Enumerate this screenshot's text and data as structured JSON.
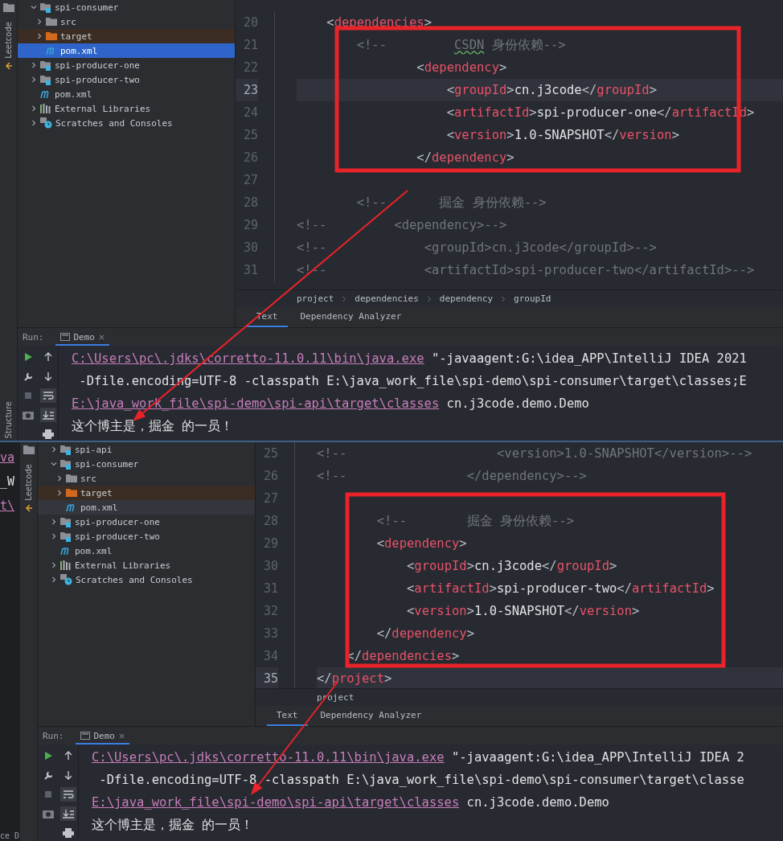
{
  "screens": [
    {
      "side_strip": {
        "top_label": "Leetcode",
        "bottom_label": "Structure"
      },
      "tree": {
        "focused": true,
        "items": [
          {
            "label": "spi-consumer",
            "kind": "module",
            "expanded": true,
            "selected": false,
            "children": [
              {
                "label": "src",
                "kind": "folder",
                "expanded": false,
                "selected": false
              },
              {
                "label": "target",
                "kind": "excluded",
                "expanded": false,
                "selected": false
              },
              {
                "label": "pom.xml",
                "kind": "maven",
                "selected": true
              }
            ]
          },
          {
            "label": "spi-producer-one",
            "kind": "module",
            "expanded": false,
            "selected": false
          },
          {
            "label": "spi-producer-two",
            "kind": "module",
            "expanded": false,
            "selected": false
          },
          {
            "label": "pom.xml",
            "kind": "maven",
            "selected": false
          },
          {
            "label": "External Libraries",
            "kind": "libraries",
            "expanded": false,
            "selected": false
          },
          {
            "label": "Scratches and Consoles",
            "kind": "scratches",
            "expanded": false,
            "selected": false
          }
        ]
      },
      "editor": {
        "lines": [
          {
            "number": "20",
            "current": false,
            "segments": [
              {
                "kind": "xml",
                "text": "    <dependencies>"
              }
            ]
          },
          {
            "number": "21",
            "current": false,
            "segments": [
              {
                "kind": "comment",
                "text": "        <!--         "
              },
              {
                "kind": "typo",
                "text": "CSDN"
              },
              {
                "kind": "comment",
                "text": " 身份依赖-->"
              }
            ]
          },
          {
            "number": "22",
            "current": false,
            "segments": [
              {
                "kind": "xml",
                "text": "                <dependency>"
              }
            ]
          },
          {
            "number": "23",
            "current": true,
            "segments": [
              {
                "kind": "xml",
                "text": "                    <groupId>cn.j3code</groupId>"
              }
            ]
          },
          {
            "number": "24",
            "current": false,
            "segments": [
              {
                "kind": "xml",
                "text": "                    <artifactId>spi-producer-one</artifactId>"
              }
            ]
          },
          {
            "number": "25",
            "current": false,
            "segments": [
              {
                "kind": "xml",
                "text": "                    <version>1.0-SNAPSHOT</version>"
              }
            ]
          },
          {
            "number": "26",
            "current": false,
            "segments": [
              {
                "kind": "xml",
                "text": "                </dependency>"
              }
            ]
          },
          {
            "number": "27",
            "current": false
          },
          {
            "number": "28",
            "current": false,
            "segments": [
              {
                "kind": "comment",
                "text": "        <!--       掘金 身份依赖-->"
              }
            ]
          },
          {
            "number": "29",
            "current": false,
            "segments": [
              {
                "kind": "comment",
                "text": "<!--         <dependency>-->"
              }
            ]
          },
          {
            "number": "30",
            "current": false,
            "segments": [
              {
                "kind": "comment",
                "text": "<!--             <groupId>cn.j3code</groupId>-->"
              }
            ]
          },
          {
            "number": "31",
            "current": false,
            "segments": [
              {
                "kind": "comment",
                "text": "<!--             <artifactId>spi-producer-two</artifactId>-->"
              }
            ]
          }
        ]
      },
      "breadcrumbs": [
        "project",
        "dependencies",
        "dependency",
        "groupId"
      ],
      "editor_tabs": [
        {
          "label": "Text",
          "selected": true
        },
        {
          "label": "Dependency Analyzer",
          "selected": false
        }
      ],
      "run": {
        "label": "Run:",
        "tab": {
          "label": "Demo",
          "selected": true
        },
        "lines": [
          [
            {
              "kind": "link",
              "text": "C:\\Users\\pc\\.jdks\\corretto-11.0.11\\bin\\java.exe"
            },
            {
              "kind": "text",
              "text": " \"-javaagent:G:\\idea_APP\\IntelliJ IDEA 2021"
            }
          ],
          [
            {
              "kind": "text",
              "text": " -Dfile.encoding=UTF-8 -classpath E:\\java_work_file\\spi-demo\\spi-consumer\\target\\classes;E"
            }
          ],
          [
            {
              "kind": "link",
              "text": "E:\\java_work_file\\spi-demo\\spi-api\\target\\classes"
            },
            {
              "kind": "text",
              "text": " cn.j3code.demo.Demo"
            }
          ],
          [
            {
              "kind": "text",
              "text": "这个博主是，掘金 的一员！"
            }
          ]
        ]
      }
    },
    {
      "edge_fragments": [
        {
          "kind": "link",
          "text": "va"
        },
        {
          "kind": "text",
          "text": "_W"
        },
        {
          "kind": "link",
          "text": "t\\"
        },
        {
          "kind": "text",
          "text": "ce D"
        }
      ],
      "side_strip": {
        "top_label": "Leetcode"
      },
      "tree": {
        "focused": false,
        "items": [
          {
            "label": "spi-api",
            "kind": "module",
            "expanded": false,
            "selected": false
          },
          {
            "label": "spi-consumer",
            "kind": "module",
            "expanded": true,
            "selected": false,
            "children": [
              {
                "label": "src",
                "kind": "folder",
                "expanded": false,
                "selected": false
              },
              {
                "label": "target",
                "kind": "excluded",
                "expanded": false,
                "selected": false
              },
              {
                "label": "pom.xml",
                "kind": "maven",
                "selected": true
              }
            ]
          },
          {
            "label": "spi-producer-one",
            "kind": "module",
            "expanded": false,
            "selected": false
          },
          {
            "label": "spi-producer-two",
            "kind": "module",
            "expanded": false,
            "selected": false
          },
          {
            "label": "pom.xml",
            "kind": "maven",
            "selected": false
          },
          {
            "label": "External Libraries",
            "kind": "libraries",
            "expanded": false,
            "selected": false
          },
          {
            "label": "Scratches and Consoles",
            "kind": "scratches",
            "expanded": false,
            "selected": false
          }
        ]
      },
      "editor": {
        "lines": [
          {
            "number": "25",
            "current": false,
            "segments": [
              {
                "kind": "comment",
                "text": "<!--                    <version>1.0-SNAPSHOT</version>-->"
              }
            ]
          },
          {
            "number": "26",
            "current": false,
            "segments": [
              {
                "kind": "comment",
                "text": "<!--                </dependency>-->"
              }
            ]
          },
          {
            "number": "27",
            "current": false
          },
          {
            "number": "28",
            "current": false,
            "segments": [
              {
                "kind": "comment",
                "text": "        <!--        掘金 身份依赖-->"
              }
            ]
          },
          {
            "number": "29",
            "current": false,
            "segments": [
              {
                "kind": "xml",
                "text": "        <dependency>"
              }
            ]
          },
          {
            "number": "30",
            "current": false,
            "segments": [
              {
                "kind": "xml",
                "text": "            <groupId>cn.j3code</groupId>"
              }
            ]
          },
          {
            "number": "31",
            "current": false,
            "segments": [
              {
                "kind": "xml",
                "text": "            <artifactId>spi-producer-two</artifactId>"
              }
            ]
          },
          {
            "number": "32",
            "current": false,
            "segments": [
              {
                "kind": "xml",
                "text": "            <version>1.0-SNAPSHOT</version>"
              }
            ]
          },
          {
            "number": "33",
            "current": false,
            "segments": [
              {
                "kind": "xml",
                "text": "        </dependency>"
              }
            ]
          },
          {
            "number": "34",
            "current": false,
            "segments": [
              {
                "kind": "xml",
                "text": "    </dependencies>"
              }
            ]
          },
          {
            "number": "35",
            "current": true,
            "segments": [
              {
                "kind": "xml",
                "text": "</project>"
              }
            ]
          }
        ]
      },
      "breadcrumbs": [
        "project"
      ],
      "editor_tabs": [
        {
          "label": "Text",
          "selected": true
        },
        {
          "label": "Dependency Analyzer",
          "selected": false
        }
      ],
      "run": {
        "label": "Run:",
        "tab": {
          "label": "Demo",
          "selected": true
        },
        "lines": [
          [
            {
              "kind": "link",
              "text": "C:\\Users\\pc\\.jdks\\corretto-11.0.11\\bin\\java.exe"
            },
            {
              "kind": "text",
              "text": " \"-javaagent:G:\\idea_APP\\IntelliJ IDEA 2"
            }
          ],
          [
            {
              "kind": "text",
              "text": " -Dfile.encoding=UTF-8 -classpath E:\\java_work_file\\spi-demo\\spi-consumer\\target\\classe"
            }
          ],
          [
            {
              "kind": "link",
              "text": "E:\\java_work_file\\spi-demo\\spi-api\\target\\classes"
            },
            {
              "kind": "text",
              "text": " cn.j3code.demo.Demo"
            }
          ],
          [
            {
              "kind": "text",
              "text": "这个博主是，掘金 的一员！"
            }
          ]
        ]
      }
    }
  ]
}
